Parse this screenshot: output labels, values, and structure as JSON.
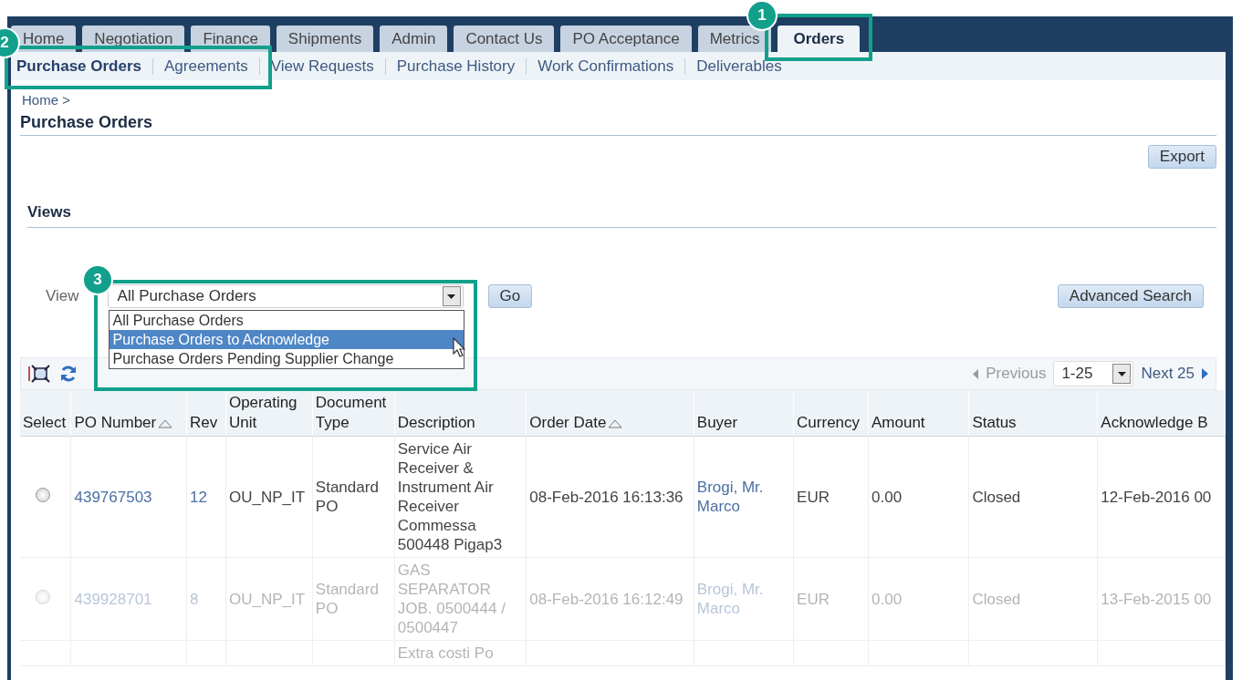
{
  "tabs": [
    {
      "label": "Home",
      "selected": false
    },
    {
      "label": "Negotiation",
      "selected": false
    },
    {
      "label": "Finance",
      "selected": false
    },
    {
      "label": "Shipments",
      "selected": false
    },
    {
      "label": "Admin",
      "selected": false
    },
    {
      "label": "Contact Us",
      "selected": false
    },
    {
      "label": "PO Acceptance",
      "selected": false
    },
    {
      "label": "Metrics",
      "selected": false
    },
    {
      "label": "Orders",
      "selected": true
    }
  ],
  "subtabs": [
    {
      "label": "Purchase Orders",
      "selected": true
    },
    {
      "label": "Agreements",
      "selected": false
    },
    {
      "label": "View Requests",
      "selected": false
    },
    {
      "label": "Purchase History",
      "selected": false
    },
    {
      "label": "Work Confirmations",
      "selected": false
    },
    {
      "label": "Deliverables",
      "selected": false
    }
  ],
  "breadcrumb": "Home >",
  "page_title": "Purchase Orders",
  "export_button": "Export",
  "views_heading": "Views",
  "view_label": "View",
  "view_select": {
    "value": "All Purchase Orders",
    "options": [
      {
        "label": "All Purchase Orders",
        "highlighted": false
      },
      {
        "label": "Purchase Orders to Acknowledge",
        "highlighted": true
      },
      {
        "label": "Purchase Orders Pending Supplier Change",
        "highlighted": false
      }
    ]
  },
  "go_button": "Go",
  "advanced_search_button": "Advanced Search",
  "pager": {
    "previous": "Previous",
    "previous_disabled": true,
    "range": "1-25",
    "next": "Next 25"
  },
  "table": {
    "columns": [
      {
        "label": "Select",
        "sorted": false,
        "kind": "radio"
      },
      {
        "label": "PO Number",
        "sorted": true,
        "kind": "link"
      },
      {
        "label": "Rev",
        "sorted": false,
        "kind": "link"
      },
      {
        "label": "Operating Unit",
        "sorted": false,
        "kind": "text"
      },
      {
        "label": "Document Type",
        "sorted": false,
        "kind": "text"
      },
      {
        "label": "Description",
        "sorted": false,
        "kind": "text"
      },
      {
        "label": "Order Date",
        "sorted": true,
        "kind": "text"
      },
      {
        "label": "Buyer",
        "sorted": false,
        "kind": "link"
      },
      {
        "label": "Currency",
        "sorted": false,
        "kind": "text"
      },
      {
        "label": "Amount",
        "sorted": false,
        "kind": "text"
      },
      {
        "label": "Status",
        "sorted": false,
        "kind": "text"
      },
      {
        "label": "Acknowledge B",
        "sorted": false,
        "kind": "text"
      }
    ],
    "rows": [
      {
        "selected": false,
        "faded": false,
        "cells": [
          "",
          "439767503",
          "12",
          "OU_NP_IT",
          "Standard PO",
          "Service Air Receiver & Instrument Air Receiver Commessa 500448 Pigap3",
          "08-Feb-2016 16:13:36",
          "Brogi, Mr. Marco",
          "EUR",
          "0.00",
          "Closed",
          "12-Feb-2016 00"
        ]
      },
      {
        "selected": false,
        "faded": true,
        "cells": [
          "",
          "439928701",
          "8",
          "OU_NP_IT",
          "Standard PO",
          "GAS SEPARATOR JOB. 0500444 / 0500447",
          "08-Feb-2016 16:12:49",
          "Brogi, Mr. Marco",
          "EUR",
          "0.00",
          "Closed",
          "13-Feb-2015 00"
        ]
      },
      {
        "faded": true,
        "cells": [
          "",
          "",
          "",
          "",
          "",
          "Extra costi Po",
          "",
          "",
          "",
          "",
          "",
          ""
        ]
      }
    ]
  },
  "callouts": [
    {
      "number": "1"
    },
    {
      "number": "2"
    },
    {
      "number": "3"
    }
  ]
}
